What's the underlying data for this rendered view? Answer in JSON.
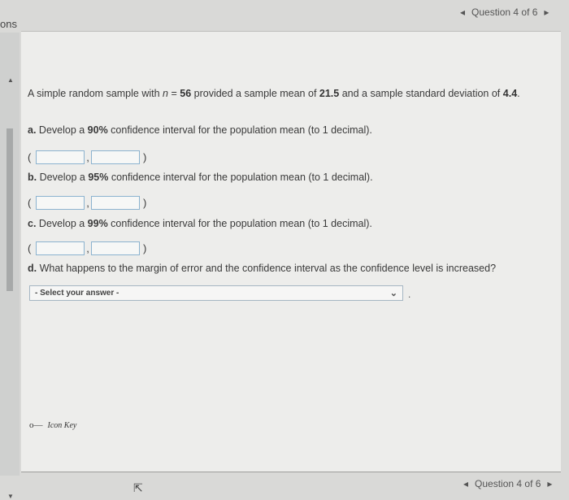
{
  "sidebar": {
    "label": "ons"
  },
  "nav": {
    "prev": "◂",
    "text": "Question 4 of 6",
    "next": "▸"
  },
  "question": {
    "intro_a": "A simple random sample with ",
    "n_sym": "n",
    "eq": " = ",
    "n": "56",
    "intro_b": " provided a sample mean of ",
    "mean": "21.5",
    "intro_c": " and a sample standard deviation of ",
    "sd": "4.4",
    "end": "."
  },
  "parts": [
    {
      "letter": "a.",
      "text_a": " Develop a ",
      "pct": "90%",
      "text_b": " confidence interval for the population mean (to 1 decimal)."
    },
    {
      "letter": "b.",
      "text_a": " Develop a ",
      "pct": "95%",
      "text_b": " confidence interval for the population mean (to 1 decimal)."
    },
    {
      "letter": "c.",
      "text_a": " Develop a ",
      "pct": "99%",
      "text_b": " confidence interval for the population mean (to 1 decimal)."
    }
  ],
  "interval": {
    "open": "(",
    "comma": ",",
    "close": ")"
  },
  "part_d": {
    "letter": "d.",
    "text": " What happens to the margin of error and the confidence interval as the confidence level is increased?"
  },
  "select": {
    "value": "- Select your answer -"
  },
  "icon_key": {
    "label": "Icon Key"
  }
}
